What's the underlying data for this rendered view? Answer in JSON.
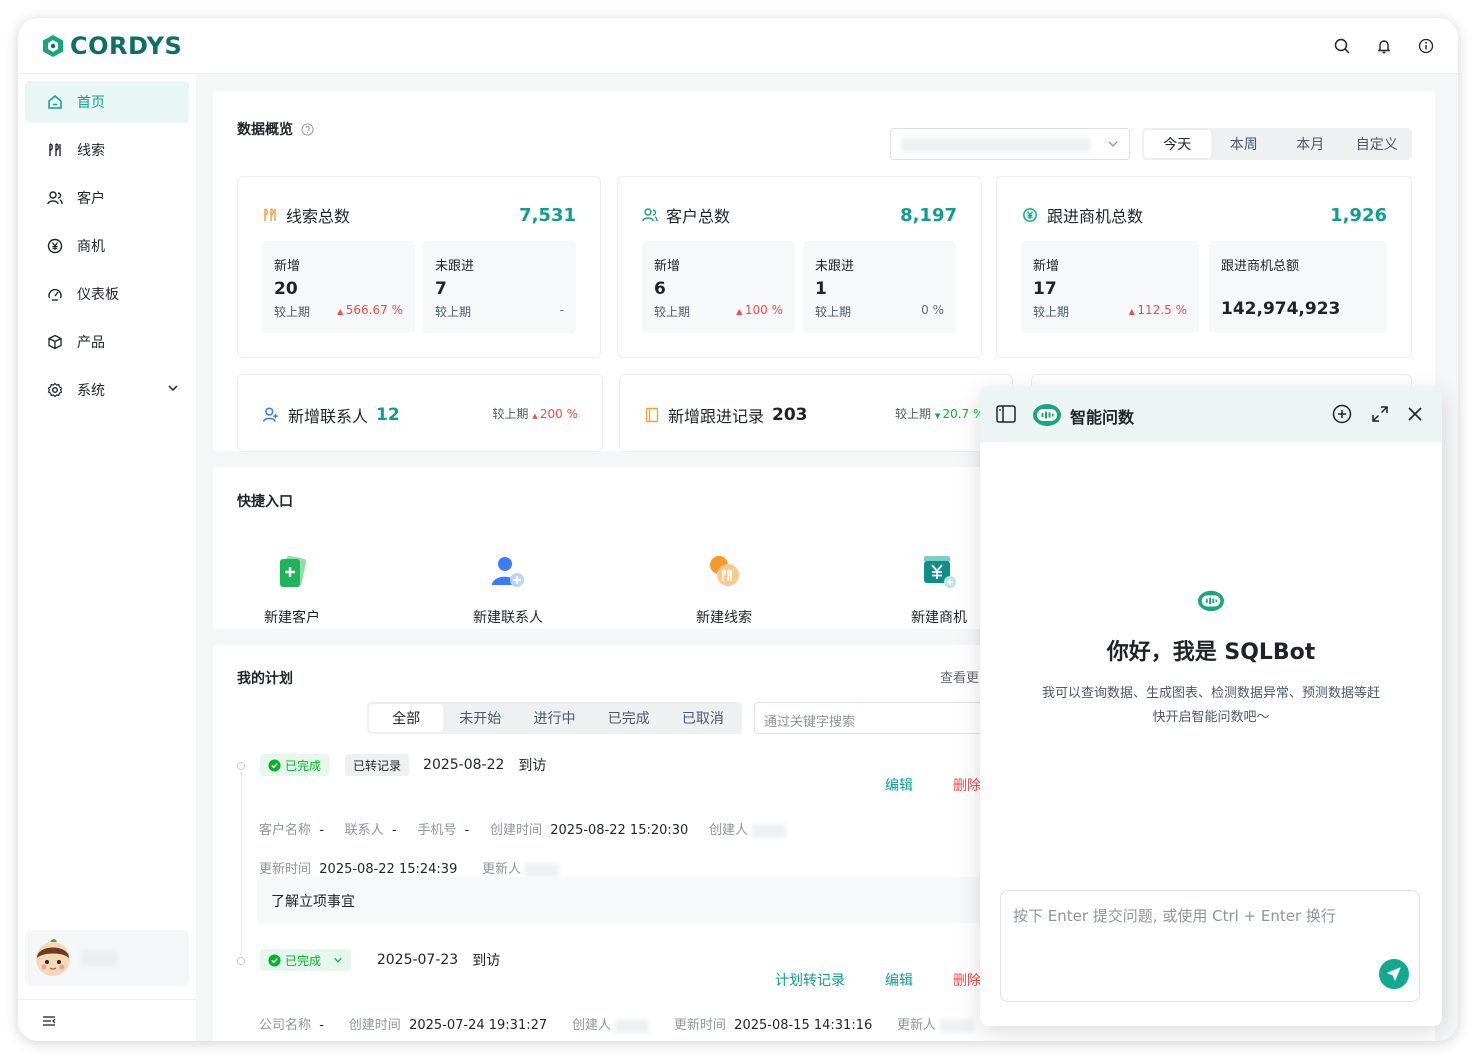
{
  "brand": {
    "name": "CORDYS",
    "color": "#0f6e67",
    "accent": "#0f9e8e"
  },
  "topbar": {
    "icons": [
      "search-icon",
      "bell-icon",
      "info-icon"
    ]
  },
  "sidebar": {
    "items": [
      {
        "label": "首页",
        "icon": "home-icon",
        "active": true
      },
      {
        "label": "线索",
        "icon": "leads-icon"
      },
      {
        "label": "客户",
        "icon": "customers-icon"
      },
      {
        "label": "商机",
        "icon": "yuan-icon"
      },
      {
        "label": "仪表板",
        "icon": "dashboard-icon"
      },
      {
        "label": "产品",
        "icon": "box-icon"
      },
      {
        "label": "系统",
        "icon": "gear-icon"
      }
    ]
  },
  "overview": {
    "title": "数据概览",
    "ranges": [
      "今天",
      "本周",
      "本月",
      "自定义"
    ],
    "cards": [
      {
        "title": "线索总数",
        "total": "7,531",
        "left": {
          "label": "新增",
          "value": "20",
          "cmp": "较上期",
          "pct": "566.67 %"
        },
        "right": {
          "label": "未跟进",
          "value": "7",
          "cmp": "较上期",
          "pct": "-"
        }
      },
      {
        "title": "客户总数",
        "total": "8,197",
        "left": {
          "label": "新增",
          "value": "6",
          "cmp": "较上期",
          "pct": "100 %"
        },
        "right": {
          "label": "未跟进",
          "value": "1",
          "cmp": "较上期",
          "pct": "0 %"
        }
      },
      {
        "title": "跟进商机总数",
        "total": "1,926",
        "left": {
          "label": "新增",
          "value": "17",
          "cmp": "较上期",
          "pct": "112.5 %"
        },
        "right": {
          "label": "跟进商机总额",
          "value": "142,974,923"
        }
      }
    ],
    "mini": [
      {
        "title": "新增联系人",
        "value": "12",
        "cmp": "较上期",
        "pct": "200 %"
      },
      {
        "title": "新增跟进记录",
        "value": "203",
        "cmp": "较上期",
        "pct": "20.7 %"
      }
    ]
  },
  "quick": {
    "title": "快捷入口",
    "items": [
      "新建客户",
      "新建联系人",
      "新建线索",
      "新建商机"
    ]
  },
  "plans": {
    "title": "我的计划",
    "view_more": "查看更",
    "tabs": [
      "全部",
      "未开始",
      "进行中",
      "已完成",
      "已取消"
    ],
    "search_placeholder": "通过关键字搜索",
    "rows": [
      {
        "status": "已完成",
        "tag": "已转记录",
        "date": "2025-08-22",
        "type": "到访",
        "actions": [
          "编辑",
          "删除"
        ],
        "meta1": {
          "customer_label": "客户名称",
          "customer": "-",
          "contact_label": "联系人",
          "contact": "-",
          "phone_label": "手机号",
          "phone": "-",
          "created_label": "创建时间",
          "created": "2025-08-22 15:20:30",
          "creator_label": "创建人"
        },
        "meta2": {
          "updated_label": "更新时间",
          "updated": "2025-08-22 15:24:39",
          "updater_label": "更新人"
        },
        "note": "了解立项事宜"
      },
      {
        "status": "已完成",
        "date": "2025-07-23",
        "type": "到访",
        "actions": [
          "计划转记录",
          "编辑",
          "删除"
        ],
        "meta1": {
          "company_label": "公司名称",
          "company": "-",
          "created_label": "创建时间",
          "created": "2025-07-24 19:31:27",
          "creator_label": "创建人",
          "updated_label": "更新时间",
          "updated": "2025-08-15 14:31:16",
          "updater_label": "更新人"
        }
      }
    ]
  },
  "bot": {
    "title": "智能问数",
    "greeting": "你好，我是 SQLBot",
    "desc1": "我可以查询数据、生成图表、检测数据异常、预测数据等赶",
    "desc2": "快开启智能问数吧～",
    "input_placeholder": "按下 Enter 提交问题, 或使用 Ctrl + Enter 换行"
  }
}
